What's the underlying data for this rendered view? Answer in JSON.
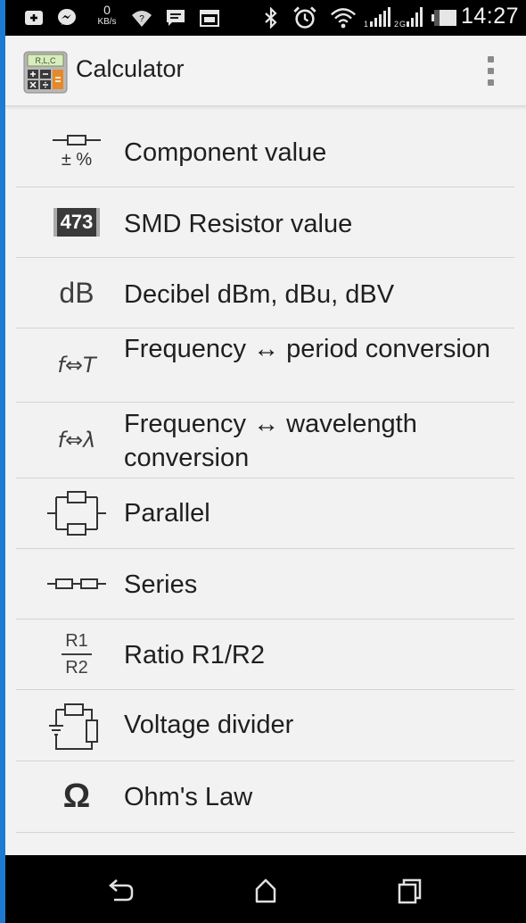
{
  "status_bar": {
    "time": "14:27",
    "net_speed_value": "0",
    "net_speed_unit": "KB/s",
    "icons": [
      "add-box-icon",
      "messenger-icon",
      "speed-icon",
      "wifi-question-icon",
      "chat-icon",
      "calendar-icon",
      "bluetooth-icon",
      "alarm-icon",
      "wifi-icon",
      "signal-1-icon",
      "signal-2-icon",
      "battery-icon"
    ]
  },
  "action_bar": {
    "title": "Calculator",
    "app_icon_text": "R,L,C"
  },
  "menu": {
    "items": [
      {
        "label": "Component value",
        "icon": "component-tolerance-icon"
      },
      {
        "label": "SMD Resistor value",
        "icon": "smd-resistor-icon",
        "icon_text": "473"
      },
      {
        "label": "Decibel dBm, dBu, dBV",
        "icon": "decibel-icon",
        "icon_text": "dB"
      },
      {
        "label": "Frequency ↔ period conversion",
        "icon": "frequency-period-icon",
        "icon_text": "f⇔T"
      },
      {
        "label": "Frequency ↔ wavelength conversion",
        "icon": "frequency-wavelength-icon",
        "icon_text": "f⇔λ"
      },
      {
        "label": "Parallel",
        "icon": "parallel-resistors-icon"
      },
      {
        "label": "Series",
        "icon": "series-resistors-icon"
      },
      {
        "label": "Ratio R1/R2",
        "icon": "ratio-icon",
        "icon_text_top": "R1",
        "icon_text_bottom": "R2"
      },
      {
        "label": "Voltage divider",
        "icon": "voltage-divider-icon"
      },
      {
        "label": "Ohm's Law",
        "icon": "ohm-icon",
        "icon_text": "Ω"
      }
    ]
  },
  "nav_bar": {
    "buttons": [
      "back-icon",
      "home-icon",
      "recents-icon"
    ]
  },
  "colors": {
    "status_bar": "#000000",
    "background": "#f2f2f2",
    "divider": "#d4d4d4",
    "text": "#1f1f1f",
    "side_strip": "#1c7ad0"
  }
}
